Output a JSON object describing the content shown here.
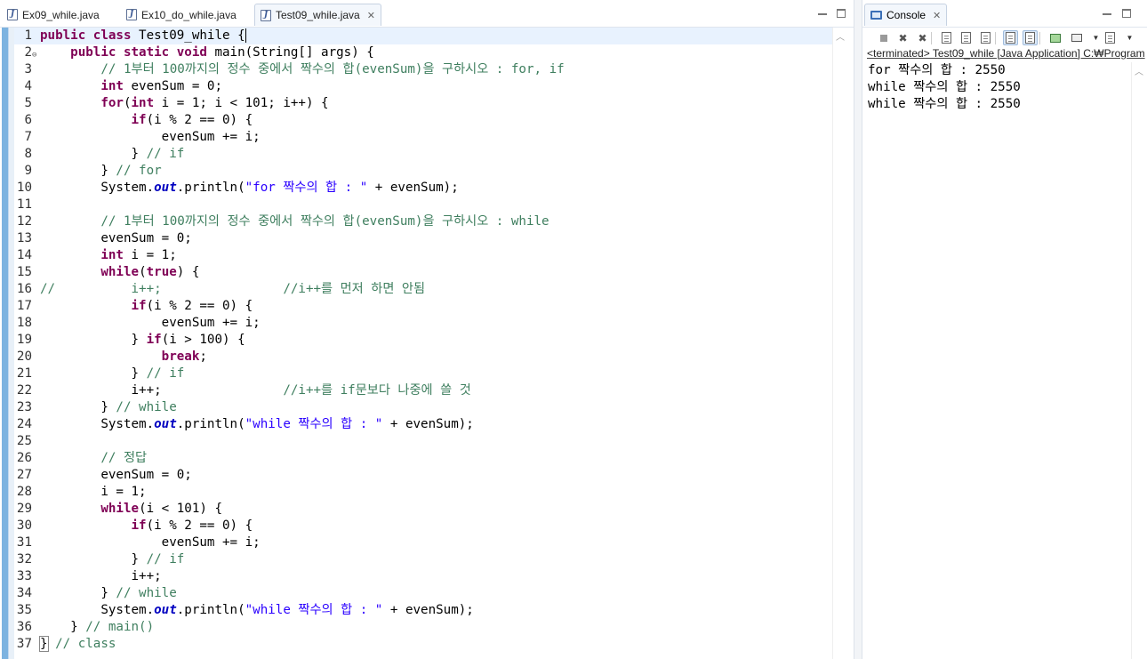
{
  "editor": {
    "tabs": [
      {
        "label": "Ex09_while.java",
        "active": false
      },
      {
        "label": "Ex10_do_while.java",
        "active": false
      },
      {
        "label": "Test09_while.java",
        "active": true
      }
    ],
    "tab_close_glyph": "✕",
    "lines": [
      {
        "num": "1",
        "html": "<span class=\"kw\">public</span> <span class=\"kw\">class</span> Test09_while {<span class=\"cursor\"></span>"
      },
      {
        "num": "2",
        "html": "    <span class=\"kw\">public</span> <span class=\"kw\">static</span> <span class=\"kw\">void</span> main(String[] args) {",
        "fold": "⊖"
      },
      {
        "num": "3",
        "html": "        <span class=\"cm\">// 1부터 100까지의 정수 중에서 짝수의 합(evenSum)을 구하시오 : for, if</span>"
      },
      {
        "num": "4",
        "html": "        <span class=\"kw\">int</span> evenSum = 0;"
      },
      {
        "num": "5",
        "html": "        <span class=\"kw\">for</span>(<span class=\"kw\">int</span> i = 1; i &lt; 101; i++) {"
      },
      {
        "num": "6",
        "html": "            <span class=\"kw\">if</span>(i % 2 == 0) {"
      },
      {
        "num": "7",
        "html": "                evenSum += i;"
      },
      {
        "num": "8",
        "html": "            } <span class=\"cm\">// if</span>"
      },
      {
        "num": "9",
        "html": "        } <span class=\"cm\">// for</span>"
      },
      {
        "num": "10",
        "html": "        System.<span class=\"fld\">out</span>.println(<span class=\"str\">\"for 짝수의 합 : \"</span> + evenSum);"
      },
      {
        "num": "11",
        "html": ""
      },
      {
        "num": "12",
        "html": "        <span class=\"cm\">// 1부터 100까지의 정수 중에서 짝수의 합(evenSum)을 구하시오 : while</span>"
      },
      {
        "num": "13",
        "html": "        evenSum = 0;"
      },
      {
        "num": "14",
        "html": "        <span class=\"kw\">int</span> i = 1;"
      },
      {
        "num": "15",
        "html": "        <span class=\"kw\">while</span>(<span class=\"kw\">true</span>) {"
      },
      {
        "num": "16",
        "html": "<span class=\"cm\">//          i++;                //i++를 먼저 하면 안됨</span>"
      },
      {
        "num": "17",
        "html": "            <span class=\"kw\">if</span>(i % 2 == 0) {"
      },
      {
        "num": "18",
        "html": "                evenSum += i;"
      },
      {
        "num": "19",
        "html": "            } <span class=\"kw\">if</span>(i &gt; 100) {"
      },
      {
        "num": "20",
        "html": "                <span class=\"kw\">break</span>;"
      },
      {
        "num": "21",
        "html": "            } <span class=\"cm\">// if</span>"
      },
      {
        "num": "22",
        "html": "            i++;                <span class=\"cm\">//i++를 if문보다 나중에 쓸 것</span>"
      },
      {
        "num": "23",
        "html": "        } <span class=\"cm\">// while</span>"
      },
      {
        "num": "24",
        "html": "        System.<span class=\"fld\">out</span>.println(<span class=\"str\">\"while 짝수의 합 : \"</span> + evenSum);"
      },
      {
        "num": "25",
        "html": ""
      },
      {
        "num": "26",
        "html": "        <span class=\"cm\">// 정답</span>"
      },
      {
        "num": "27",
        "html": "        evenSum = 0;"
      },
      {
        "num": "28",
        "html": "        i = 1;"
      },
      {
        "num": "29",
        "html": "        <span class=\"kw\">while</span>(i &lt; 101) {"
      },
      {
        "num": "30",
        "html": "            <span class=\"kw\">if</span>(i % 2 == 0) {"
      },
      {
        "num": "31",
        "html": "                evenSum += i;"
      },
      {
        "num": "32",
        "html": "            } <span class=\"cm\">// if</span>"
      },
      {
        "num": "33",
        "html": "            i++;"
      },
      {
        "num": "34",
        "html": "        } <span class=\"cm\">// while</span>"
      },
      {
        "num": "35",
        "html": "        System.<span class=\"fld\">out</span>.println(<span class=\"str\">\"while 짝수의 합 : \"</span> + evenSum);"
      },
      {
        "num": "36",
        "html": "    } <span class=\"cm\">// main()</span>"
      },
      {
        "num": "37",
        "html": "<span class=\"bracket\">}</span> <span class=\"cm\">// class</span>"
      }
    ]
  },
  "console": {
    "tab_label": "Console",
    "tab_close_glyph": "✕",
    "status": "<terminated> Test09_while [Java Application] C:₩Program",
    "output": [
      "for 짝수의 합 : 2550",
      "while 짝수의 합 : 2550",
      "while 짝수의 합 : 2550"
    ],
    "toolbar": [
      {
        "name": "terminate-icon",
        "glyph": "sq"
      },
      {
        "name": "remove-launch-icon",
        "glyph": "✖"
      },
      {
        "name": "remove-all-terminated-icon",
        "glyph": "✖"
      },
      {
        "name": "clear-console-icon",
        "glyph": "doc"
      },
      {
        "name": "scroll-lock-icon",
        "glyph": "doc"
      },
      {
        "name": "word-wrap-icon",
        "glyph": "doc"
      },
      {
        "name": "show-on-stdout-icon",
        "glyph": "doc",
        "pressed": true
      },
      {
        "name": "show-on-stderr-icon",
        "glyph": "doc",
        "pressed": true
      },
      {
        "name": "pin-console-icon",
        "glyph": "green"
      },
      {
        "name": "display-console-icon",
        "glyph": "mon"
      },
      {
        "name": "display-console-dropdown-icon",
        "glyph": "caret"
      },
      {
        "name": "open-console-icon",
        "glyph": "doc"
      },
      {
        "name": "open-console-dropdown-icon",
        "glyph": "caret"
      }
    ]
  }
}
